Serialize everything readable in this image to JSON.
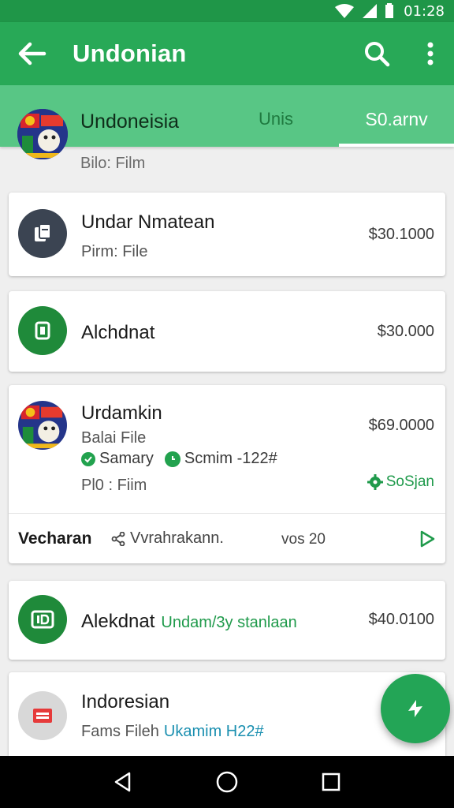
{
  "status_bar": {
    "time": "01:28",
    "wifi_icon": "wifi-icon",
    "signal_icon": "signal-icon",
    "battery_icon": "battery-icon"
  },
  "app_bar": {
    "title": "Undonian",
    "back_icon": "arrow-left-icon",
    "search_icon": "search-icon",
    "more_icon": "more-vert-icon"
  },
  "tabs": {
    "header_name": "Undoneisia",
    "header_sub": "Bilo: Film",
    "tab_1": "Unis",
    "tab_2": "S0.arnv"
  },
  "cards": [
    {
      "title": "Undar Nmatean",
      "subtitle": "Pirm: File",
      "price": "$30.1000",
      "icon": "document-icon"
    },
    {
      "title": "Alchdnat",
      "price": "$30.000",
      "icon": "rectangle-icon"
    },
    {
      "title": "Urdamkin",
      "subtitle": "Balai File",
      "chip_1": "Samary",
      "chip_2": "Scmim -122#",
      "line_3": "Pl0 : Fiim",
      "price": "$69.0000",
      "status": "SoSjan",
      "action_1": "Vecharan",
      "action_2": "Vvrahrakann.",
      "action_3": "vos 20",
      "play_icon": "play-icon"
    },
    {
      "title": "Alekdnat",
      "title_suffix": "Undam/3y stanlaan",
      "price": "$40.0100",
      "icon": "id-icon"
    },
    {
      "title": "Indoresian",
      "subtitle": "Fams Fileh",
      "subtitle_suffix": "Ukamim H22#",
      "icon": "calendar-icon"
    }
  ],
  "fab": {
    "icon": "bolt-icon"
  },
  "nav": {
    "back_icon": "triangle-back-icon",
    "home_icon": "circle-home-icon",
    "recents_icon": "square-recents-icon"
  },
  "colors": {
    "primary": "#28a957",
    "primary_dark": "#1f9648",
    "tab_strip": "#58c685",
    "accent": "#23a556"
  }
}
